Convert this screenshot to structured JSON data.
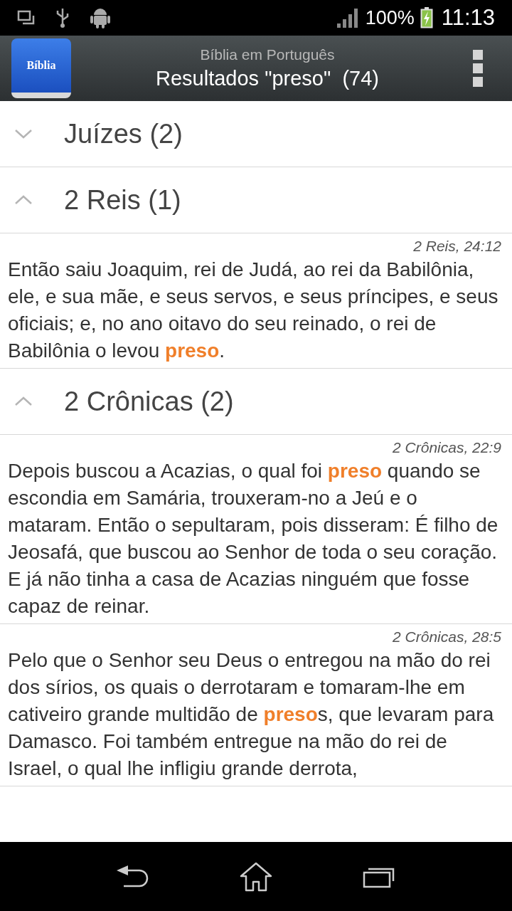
{
  "status_bar": {
    "battery": "100%",
    "time": "11:13"
  },
  "header": {
    "app_icon_label": "Bíblia",
    "subtitle": "Bíblia em Português",
    "title": "Resultados \"preso\"  (74)"
  },
  "groups": [
    {
      "title": "Juízes (2)",
      "expanded": false
    },
    {
      "title": "2 Reis (1)",
      "expanded": true,
      "verses": [
        {
          "reference": "2 Reis, 24:12",
          "text": "Então saiu Joaquim, rei de Judá, ao rei da Babilônia, ele, e sua mãe, e seus servos, e seus príncipes, e seus oficiais; e, no ano oitavo do seu reinado, o rei de Babilônia o levou **preso**."
        }
      ]
    },
    {
      "title": "2 Crônicas (2)",
      "expanded": true,
      "verses": [
        {
          "reference": "2 Crônicas, 22:9",
          "text": "Depois buscou a Acazias, o qual foi **preso** quando se escondia em Samária, trouxeram-no a Jeú e o mataram. Então o sepultaram, pois disseram: É filho de Jeosafá, que buscou ao Senhor de toda o seu coração. E já não tinha a casa de Acazias ninguém que fosse capaz de reinar."
        },
        {
          "reference": "2 Crônicas, 28:5",
          "text": "Pelo que o Senhor seu Deus o entregou na mão do rei dos sírios, os quais o derrotaram e tomaram-lhe em cativeiro grande multidão de **preso**s, que levaram para Damasco. Foi também entregue na mão do rei de Israel, o qual lhe infligiu grande derrota,"
        }
      ]
    }
  ]
}
